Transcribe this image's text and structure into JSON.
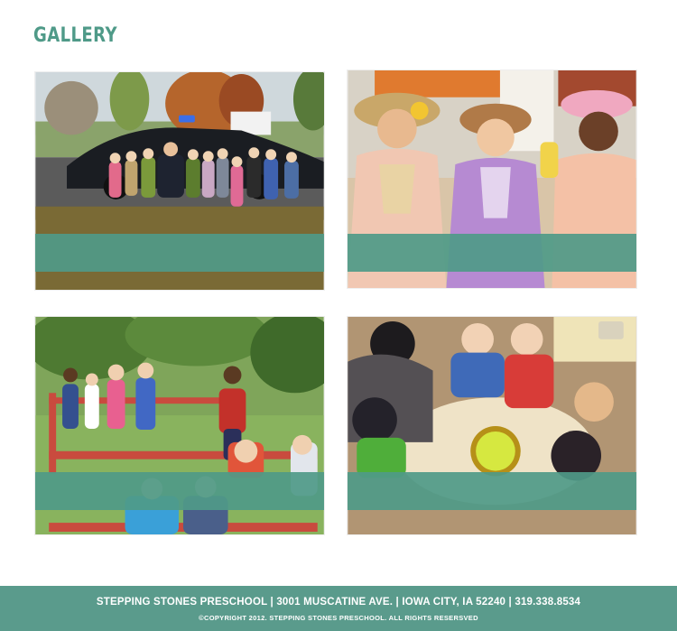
{
  "page": {
    "title": "GALLERY"
  },
  "gallery": {
    "accent_color": "#4f9a88",
    "items": [
      {
        "name": "police-car-kids-photo"
      },
      {
        "name": "princess-costumes-photo"
      },
      {
        "name": "playground-kids-photo"
      },
      {
        "name": "classroom-slime-activity-photo"
      }
    ]
  },
  "footer": {
    "contact_line": "STEPPING STONES PRESCHOOL | 3001 MUSCATINE AVE. | IOWA CITY, IA 52240 | 319.338.8534",
    "copyright": "©COPYRIGHT 2012. STEPPING STONES PRESCHOOL. ALL RIGHTS RESERSVED",
    "background_color": "#5a9b8c"
  }
}
